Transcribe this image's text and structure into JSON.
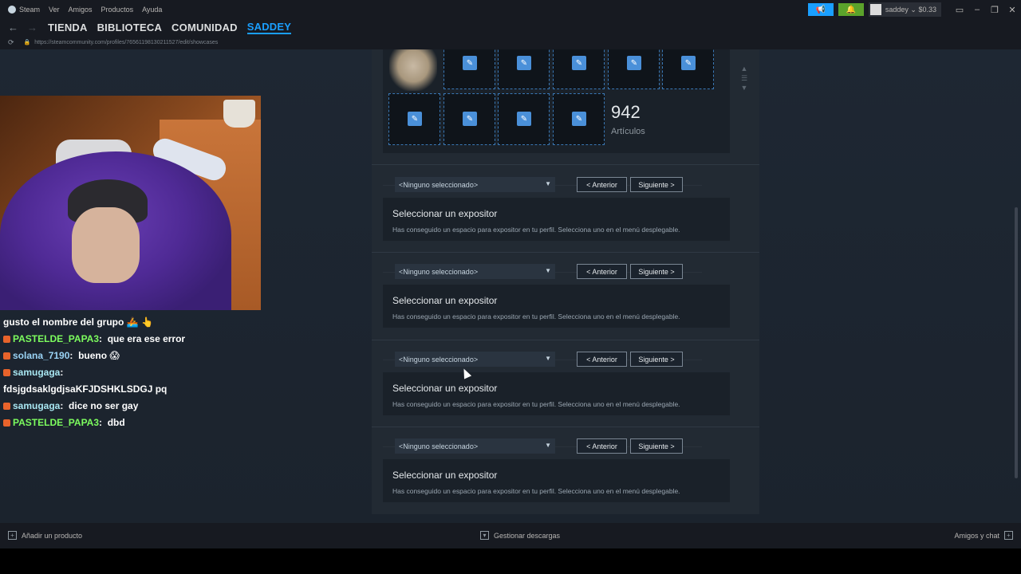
{
  "menubar": {
    "app_name": "Steam",
    "items": [
      "Ver",
      "Amigos",
      "Productos",
      "Ayuda"
    ],
    "user_label": "saddey ⌄ $0.33"
  },
  "nav": {
    "links": [
      "TIENDA",
      "BIBLIOTECA",
      "COMUNIDAD",
      "SADDEY"
    ],
    "active": "SADDEY",
    "url": "https://steamcommunity.com/profiles/76561198130211527/edit/showcases"
  },
  "items_showcase": {
    "count": "942",
    "count_label": "Artículos"
  },
  "showcases": [
    {
      "select_value": "<Ninguno seleccionado>",
      "prev_label": "< Anterior",
      "next_label": "Siguiente >",
      "title": "Seleccionar un expositor",
      "description": "Has conseguido un espacio para expositor en tu perfil. Selecciona uno en el menú desplegable."
    },
    {
      "select_value": "<Ninguno seleccionado>",
      "prev_label": "< Anterior",
      "next_label": "Siguiente >",
      "title": "Seleccionar un expositor",
      "description": "Has conseguido un espacio para expositor en tu perfil. Selecciona uno en el menú desplegable."
    },
    {
      "select_value": "<Ninguno seleccionado>",
      "prev_label": "< Anterior",
      "next_label": "Siguiente >",
      "title": "Seleccionar un expositor",
      "description": "Has conseguido un espacio para expositor en tu perfil. Selecciona uno en el menú desplegable."
    },
    {
      "select_value": "<Ninguno seleccionado>",
      "prev_label": "< Anterior",
      "next_label": "Siguiente >",
      "title": "Seleccionar un expositor",
      "description": "Has conseguido un espacio para expositor en tu perfil. Selecciona uno en el menú desplegable."
    }
  ],
  "chat": {
    "lines": [
      {
        "user": "",
        "text": "gusto el nombre del grupo 🚣 👆"
      },
      {
        "user": "PASTELDE_PAPA3",
        "text": "que era ese error"
      },
      {
        "user": "solana_7190",
        "text": "bueno 😱"
      },
      {
        "user": "samugaga",
        "text": ""
      },
      {
        "user": "",
        "text": "fdsjgdsaklgdjsaKFJDSHKLSDGJ pq"
      },
      {
        "user": "samugaga",
        "text": "dice no ser gay"
      },
      {
        "user": "PASTELDE_PAPA3",
        "text": "dbd"
      }
    ]
  },
  "bottombar": {
    "add_product": "Añadir un producto",
    "manage_downloads": "Gestionar descargas",
    "friends_chat": "Amigos y chat"
  },
  "colors": {
    "accent": "#1a9fff",
    "slot_border": "#3a78b5",
    "edit_icon": "#4a90d9",
    "chat_green": "#7cfc5e",
    "chat_blue": "#9ad3f5"
  }
}
